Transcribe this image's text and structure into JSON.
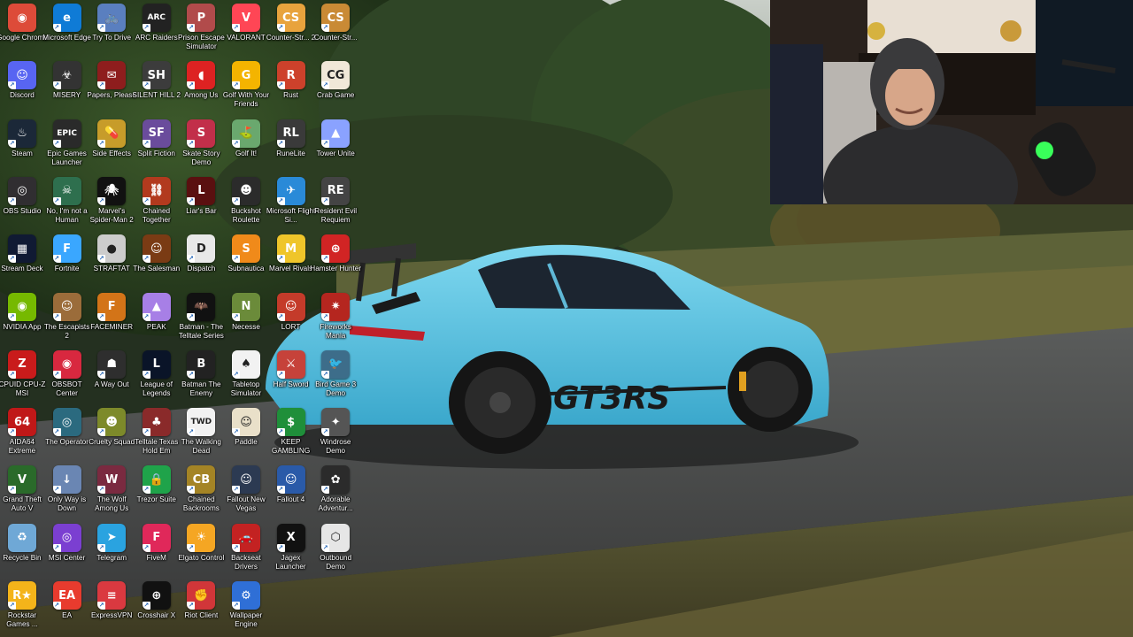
{
  "colors": {
    "accent_car": "#5fc6e6",
    "icon_label": "#ffffff",
    "webcam_light": "#39ff5a"
  },
  "webcam": {
    "icon": "streamer-webcam-feed"
  },
  "wallpaper": {
    "icon": "blue-porsche-911-gt3-rs-wallpaper",
    "decal": "GT3RS"
  },
  "desktop": {
    "icons": [
      {
        "label": "Google Chrome",
        "icon": "chrome-icon",
        "color": "#dd4b39",
        "glyph": "◉"
      },
      {
        "label": "Microsoft Edge",
        "icon": "edge-icon",
        "color": "#0f7bd6",
        "glyph": "e"
      },
      {
        "label": "Try To Drive",
        "icon": "try-to-drive-icon",
        "color": "#5a7fbf",
        "glyph": "🚲"
      },
      {
        "label": "ARC Raiders",
        "icon": "arc-raiders-icon",
        "color": "#222",
        "glyph": "ARC"
      },
      {
        "label": "Prison Escape Simulator",
        "icon": "prison-escape-icon",
        "color": "#b14b4b",
        "glyph": "P"
      },
      {
        "label": "VALORANT",
        "icon": "valorant-icon",
        "color": "#ff4655",
        "glyph": "V"
      },
      {
        "label": "Counter-Str... 2",
        "icon": "counter-strike-2-icon",
        "color": "#e8a33d",
        "glyph": "CS"
      },
      {
        "label": "Counter-Str...",
        "icon": "counter-strike-icon",
        "color": "#c98a35",
        "glyph": "CS"
      },
      {
        "label": "Discord",
        "icon": "discord-icon",
        "color": "#5865f2",
        "glyph": "☺"
      },
      {
        "label": "MISERY",
        "icon": "misery-icon",
        "color": "#333",
        "glyph": "☣"
      },
      {
        "label": "Papers, Please",
        "icon": "papers-please-icon",
        "color": "#8e1d1d",
        "glyph": "✉"
      },
      {
        "label": "SILENT HILL 2",
        "icon": "silent-hill-2-icon",
        "color": "#3c3c3c",
        "glyph": "SH"
      },
      {
        "label": "Among Us",
        "icon": "among-us-icon",
        "color": "#d22",
        "glyph": "◖"
      },
      {
        "label": "Golf With Your Friends",
        "icon": "golf-with-friends-icon",
        "color": "#f4b400",
        "glyph": "G"
      },
      {
        "label": "Rust",
        "icon": "rust-icon",
        "color": "#cd412b",
        "glyph": "R"
      },
      {
        "label": "Crab Game",
        "icon": "crab-game-icon",
        "color": "#f0e8d8",
        "glyph": "CG"
      },
      {
        "label": "Steam",
        "icon": "steam-icon",
        "color": "#1b2838",
        "glyph": "♨"
      },
      {
        "label": "Epic Games Launcher",
        "icon": "epic-games-icon",
        "color": "#2a2a2a",
        "glyph": "EPIC"
      },
      {
        "label": "Side Effects",
        "icon": "side-effects-icon",
        "color": "#c79c2a",
        "glyph": "💊"
      },
      {
        "label": "Split Fiction",
        "icon": "split-fiction-icon",
        "color": "#6a4c9c",
        "glyph": "SF"
      },
      {
        "label": "Skate Story Demo",
        "icon": "skate-story-icon",
        "color": "#c22f4a",
        "glyph": "S"
      },
      {
        "label": "Golf It!",
        "icon": "golf-it-icon",
        "color": "#6aa86e",
        "glyph": "⛳"
      },
      {
        "label": "RuneLite",
        "icon": "runelite-icon",
        "color": "#3a3a3a",
        "glyph": "RL"
      },
      {
        "label": "Tower Unite",
        "icon": "tower-unite-icon",
        "color": "#8aa2ff",
        "glyph": "▲"
      },
      {
        "label": "OBS Studio",
        "icon": "obs-studio-icon",
        "color": "#302e31",
        "glyph": "◎"
      },
      {
        "label": "No, I'm not a Human",
        "icon": "not-a-human-icon",
        "color": "#2e6f4e",
        "glyph": "☠"
      },
      {
        "label": "Marvel's Spider-Man 2",
        "icon": "spider-man-2-icon",
        "color": "#111",
        "glyph": "🕷"
      },
      {
        "label": "Chained Together",
        "icon": "chained-together-icon",
        "color": "#b23a1e",
        "glyph": "⛓"
      },
      {
        "label": "Liar's Bar",
        "icon": "liars-bar-icon",
        "color": "#5a1010",
        "glyph": "L"
      },
      {
        "label": "Buckshot Roulette",
        "icon": "buckshot-roulette-icon",
        "color": "#2b2b2b",
        "glyph": "☻"
      },
      {
        "label": "Microsoft Flight Si...",
        "icon": "flight-simulator-icon",
        "color": "#2a8ad8",
        "glyph": "✈"
      },
      {
        "label": "Resident Evil Requiem",
        "icon": "resident-evil-requiem-icon",
        "color": "#444",
        "glyph": "RE"
      },
      {
        "label": "Stream Deck",
        "icon": "stream-deck-icon",
        "color": "#101a33",
        "glyph": "▦"
      },
      {
        "label": "Fortnite",
        "icon": "fortnite-icon",
        "color": "#3aa7ff",
        "glyph": "F"
      },
      {
        "label": "STRAFTAT",
        "icon": "straftat-icon",
        "color": "#ccc",
        "glyph": "●"
      },
      {
        "label": "The Salesman",
        "icon": "the-salesman-icon",
        "color": "#7a3b14",
        "glyph": "☺"
      },
      {
        "label": "Dispatch",
        "icon": "dispatch-icon",
        "color": "#e8e8e8",
        "glyph": "D"
      },
      {
        "label": "Subnautica",
        "icon": "subnautica-icon",
        "color": "#f08a1a",
        "glyph": "S"
      },
      {
        "label": "Marvel Rivals",
        "icon": "marvel-rivals-icon",
        "color": "#efc52a",
        "glyph": "M"
      },
      {
        "label": "Hamster Hunter",
        "icon": "hamster-hunter-icon",
        "color": "#d12424",
        "glyph": "⊕"
      },
      {
        "label": "NVIDIA App",
        "icon": "nvidia-icon",
        "color": "#76b900",
        "glyph": "◉"
      },
      {
        "label": "The Escapists 2",
        "icon": "escapists-2-icon",
        "color": "#9b6c3a",
        "glyph": "☺"
      },
      {
        "label": "FACEMINER",
        "icon": "faceminer-icon",
        "color": "#d37418",
        "glyph": "F"
      },
      {
        "label": "PEAK",
        "icon": "peak-icon",
        "color": "#a77fe6",
        "glyph": "▲"
      },
      {
        "label": "Batman - The Telltale Series",
        "icon": "batman-telltale-icon",
        "color": "#111",
        "glyph": "🦇"
      },
      {
        "label": "Necesse",
        "icon": "necesse-icon",
        "color": "#6b8b3a",
        "glyph": "N"
      },
      {
        "label": "LORT",
        "icon": "lort-icon",
        "color": "#c43b2a",
        "glyph": "☺"
      },
      {
        "label": "Fireworks Mania",
        "icon": "fireworks-mania-icon",
        "color": "#b5261f",
        "glyph": "✷"
      },
      {
        "label": "CPUID CPU-Z MSI",
        "icon": "cpu-z-icon",
        "color": "#c91b1b",
        "glyph": "Z"
      },
      {
        "label": "OBSBOT Center",
        "icon": "obsbot-icon",
        "color": "#d8283f",
        "glyph": "◉"
      },
      {
        "label": "A Way Out",
        "icon": "a-way-out-icon",
        "color": "#2e2e2e",
        "glyph": "☗"
      },
      {
        "label": "League of Legends",
        "icon": "league-of-legends-icon",
        "color": "#0a1428",
        "glyph": "L"
      },
      {
        "label": "Batman The Enemy",
        "icon": "batman-enemy-icon",
        "color": "#222",
        "glyph": "B"
      },
      {
        "label": "Tabletop Simulator",
        "icon": "tabletop-simulator-icon",
        "color": "#f2f2f2",
        "glyph": "♠"
      },
      {
        "label": "Half Sword",
        "icon": "half-sword-icon",
        "color": "#c6423a",
        "glyph": "⚔"
      },
      {
        "label": "Bird Game 3 Demo",
        "icon": "bird-game-3-icon",
        "color": "#3d6d8a",
        "glyph": "🐦"
      },
      {
        "label": "AIDA64 Extreme",
        "icon": "aida64-icon",
        "color": "#c01818",
        "glyph": "64"
      },
      {
        "label": "The Operator",
        "icon": "the-operator-icon",
        "color": "#2b6a7f",
        "glyph": "◎"
      },
      {
        "label": "Cruelty Squad",
        "icon": "cruelty-squad-icon",
        "color": "#7d8a2a",
        "glyph": "☻"
      },
      {
        "label": "Telltale Texas Hold Em",
        "icon": "texas-hold-em-icon",
        "color": "#8a2a2a",
        "glyph": "♣"
      },
      {
        "label": "The Walking Dead",
        "icon": "walking-dead-icon",
        "color": "#f2f2f2",
        "glyph": "TWD"
      },
      {
        "label": "Paddle",
        "icon": "paddle-icon",
        "color": "#e9e0c9",
        "glyph": "☺"
      },
      {
        "label": "KEEP GAMBLING",
        "icon": "keep-gambling-icon",
        "color": "#1f8f3a",
        "glyph": "$"
      },
      {
        "label": "Windrose Demo",
        "icon": "windrose-icon",
        "color": "#555",
        "glyph": "✦"
      },
      {
        "label": "Grand Theft Auto V",
        "icon": "gta-v-icon",
        "color": "#2a6a2a",
        "glyph": "V"
      },
      {
        "label": "Only Way is Down",
        "icon": "only-way-is-down-icon",
        "color": "#6a86b3",
        "glyph": "↓"
      },
      {
        "label": "The Wolf Among Us",
        "icon": "wolf-among-us-icon",
        "color": "#7a2a40",
        "glyph": "W"
      },
      {
        "label": "Trezor Suite",
        "icon": "trezor-suite-icon",
        "color": "#1fa34a",
        "glyph": "🔒"
      },
      {
        "label": "Chained Backrooms",
        "icon": "chained-backrooms-icon",
        "color": "#a48425",
        "glyph": "CB"
      },
      {
        "label": "Fallout New Vegas",
        "icon": "fallout-new-vegas-icon",
        "color": "#2c3a52",
        "glyph": "☺"
      },
      {
        "label": "Fallout 4",
        "icon": "fallout-4-icon",
        "color": "#2a5aa8",
        "glyph": "☺"
      },
      {
        "label": "Adorable Adventur...",
        "icon": "adorable-adventures-icon",
        "color": "#2b2b2b",
        "glyph": "✿"
      },
      {
        "label": "Recycle Bin",
        "icon": "recycle-bin-icon",
        "color": "#6fa8d6",
        "glyph": "♻"
      },
      {
        "label": "MSI Center",
        "icon": "msi-center-icon",
        "color": "#7b3fd1",
        "glyph": "◎"
      },
      {
        "label": "Telegram",
        "icon": "telegram-icon",
        "color": "#2aa3e0",
        "glyph": "➤"
      },
      {
        "label": "FiveM",
        "icon": "fivem-icon",
        "color": "#e0285a",
        "glyph": "F"
      },
      {
        "label": "Elgato Control",
        "icon": "elgato-control-icon",
        "color": "#f5a623",
        "glyph": "☀"
      },
      {
        "label": "Backseat Drivers",
        "icon": "backseat-drivers-icon",
        "color": "#c32222",
        "glyph": "🚗"
      },
      {
        "label": "Jagex Launcher",
        "icon": "jagex-launcher-icon",
        "color": "#111",
        "glyph": "X"
      },
      {
        "label": "Outbound Demo",
        "icon": "outbound-icon",
        "color": "#e6e6e6",
        "glyph": "⬡"
      },
      {
        "label": "Rockstar Games ...",
        "icon": "rockstar-games-icon",
        "color": "#f4b41a",
        "glyph": "R★"
      },
      {
        "label": "EA",
        "icon": "ea-icon",
        "color": "#e83b2e",
        "glyph": "EA"
      },
      {
        "label": "ExpressVPN",
        "icon": "expressvpn-icon",
        "color": "#da3940",
        "glyph": "≡"
      },
      {
        "label": "Crosshair X",
        "icon": "crosshair-x-icon",
        "color": "#111",
        "glyph": "⊕"
      },
      {
        "label": "Riot Client",
        "icon": "riot-client-icon",
        "color": "#d13639",
        "glyph": "✊"
      },
      {
        "label": "Wallpaper Engine",
        "icon": "wallpaper-engine-icon",
        "color": "#2f6fd6",
        "glyph": "⚙"
      }
    ]
  }
}
